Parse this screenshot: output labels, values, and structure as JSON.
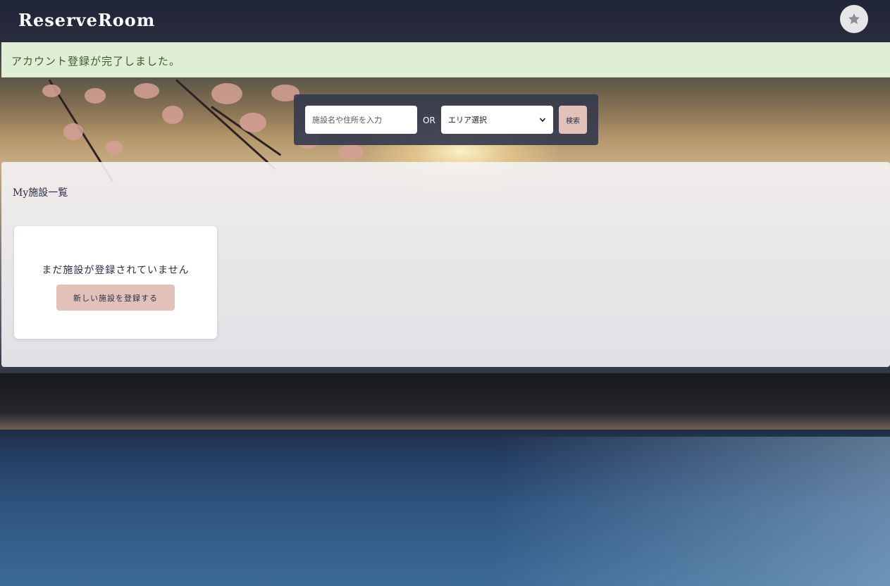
{
  "header": {
    "brand": "ReserveRoom",
    "favorite_icon": "star-icon"
  },
  "alert": {
    "message": "アカウント登録が完了しました。"
  },
  "search": {
    "placeholder": "施設名や住所を入力",
    "value": "",
    "or_label": "OR",
    "area_select_value": "エリア選択",
    "submit_label": "検索"
  },
  "facilities": {
    "title": "My施設一覧",
    "empty_message": "まだ施設が登録されていません",
    "register_button": "新しい施設を登録する"
  },
  "colors": {
    "accent": "#e3c1bb",
    "navy": "#2a2e45",
    "alert_bg": "#dfeed4",
    "alert_text": "#3c5b2d"
  }
}
